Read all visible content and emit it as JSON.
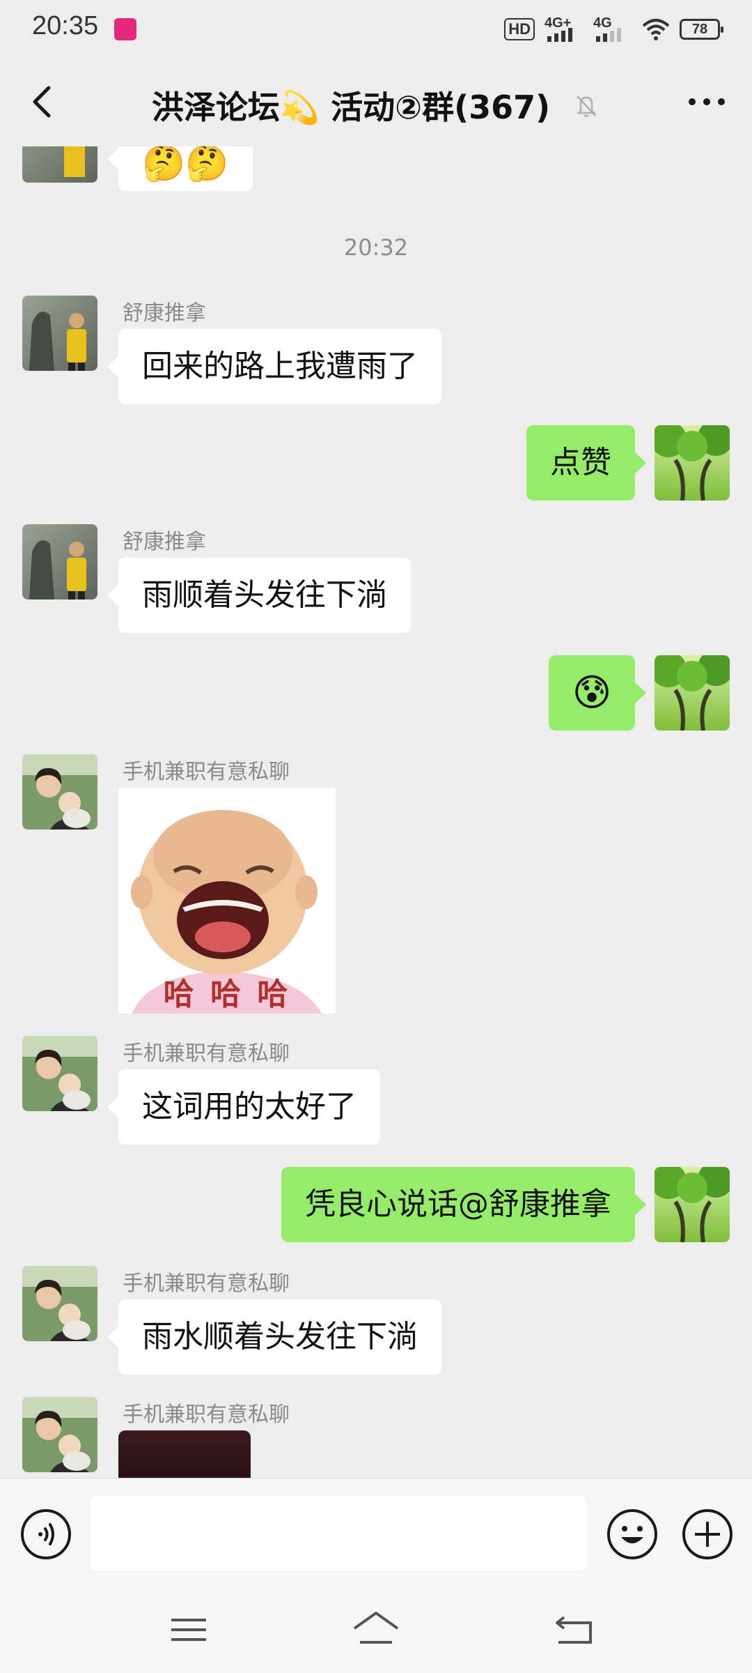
{
  "status_bar": {
    "time": "20:35",
    "hd_label": "HD",
    "network_1": "4G+",
    "network_2": "4G",
    "battery": "78"
  },
  "header": {
    "title": "洪泽论坛💫 活动②群(367)",
    "icons": [
      "back-icon",
      "mute-bell-icon",
      "more-icon"
    ]
  },
  "chat": {
    "timestamp": "20:32",
    "messages": [
      {
        "side": "in",
        "sender": "舒康推拿",
        "text": "回来的路上我遭雨了"
      },
      {
        "side": "out",
        "text": "点赞"
      },
      {
        "side": "in",
        "sender": "舒康推拿",
        "text": "雨顺着头发往下淌"
      },
      {
        "side": "out",
        "type": "emoji",
        "emoji": "😰"
      },
      {
        "side": "in",
        "sender": "手机兼职有意私聊",
        "type": "sticker",
        "caption": "哈 哈 哈"
      },
      {
        "side": "in",
        "sender": "手机兼职有意私聊",
        "text": "这词用的太好了"
      },
      {
        "side": "out",
        "text": "凭良心说话@舒康推拿"
      },
      {
        "side": "in",
        "sender": "手机兼职有意私聊",
        "text": "雨水顺着头发往下淌"
      },
      {
        "side": "in",
        "sender": "手机兼职有意私聊",
        "type": "image"
      }
    ],
    "partial_top_emoji": "🤔🤔"
  },
  "input_bar": {
    "placeholder": "",
    "icons": [
      "voice-icon",
      "emoji-icon",
      "plus-icon"
    ]
  },
  "system_nav": {
    "icons": [
      "menu-icon",
      "home-icon",
      "back-nav-icon"
    ]
  },
  "colors": {
    "background": "#ededed",
    "bubble_out": "#95ec69",
    "bubble_in": "#ffffff",
    "sender_text": "#8a8a8a"
  }
}
